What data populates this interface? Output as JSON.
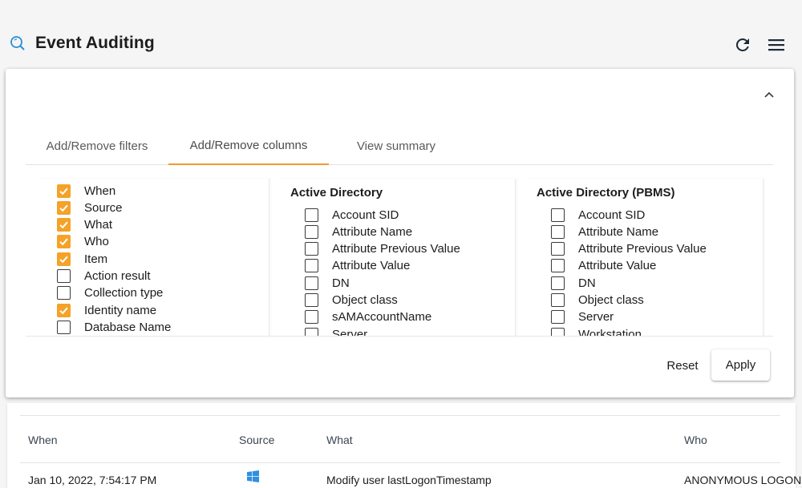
{
  "header": {
    "title": "Event Auditing",
    "icon": "search-icon",
    "actions": [
      "refresh-icon",
      "hamburger-menu-icon"
    ]
  },
  "panel": {
    "tabs": [
      {
        "label": "Add/Remove filters",
        "active": false
      },
      {
        "label": "Add/Remove columns",
        "active": true
      },
      {
        "label": "View summary",
        "active": false
      }
    ],
    "columns": [
      {
        "title": "",
        "options": [
          {
            "label": "When",
            "checked": true
          },
          {
            "label": "Source",
            "checked": true
          },
          {
            "label": "What",
            "checked": true
          },
          {
            "label": "Who",
            "checked": true
          },
          {
            "label": "Item",
            "checked": true
          },
          {
            "label": "Action result",
            "checked": false
          },
          {
            "label": "Collection type",
            "checked": false
          },
          {
            "label": "Identity name",
            "checked": true
          },
          {
            "label": "Database Name",
            "checked": false
          }
        ]
      },
      {
        "title": "Active Directory",
        "options": [
          {
            "label": "Account SID",
            "checked": false
          },
          {
            "label": "Attribute Name",
            "checked": false
          },
          {
            "label": "Attribute Previous Value",
            "checked": false
          },
          {
            "label": "Attribute Value",
            "checked": false
          },
          {
            "label": "DN",
            "checked": false
          },
          {
            "label": "Object class",
            "checked": false
          },
          {
            "label": "sAMAccountName",
            "checked": false
          },
          {
            "label": "Server",
            "checked": false
          }
        ]
      },
      {
        "title": "Active Directory (PBMS)",
        "options": [
          {
            "label": "Account SID",
            "checked": false
          },
          {
            "label": "Attribute Name",
            "checked": false
          },
          {
            "label": "Attribute Previous Value",
            "checked": false
          },
          {
            "label": "Attribute Value",
            "checked": false
          },
          {
            "label": "DN",
            "checked": false
          },
          {
            "label": "Object class",
            "checked": false
          },
          {
            "label": "Server",
            "checked": false
          },
          {
            "label": "Workstation",
            "checked": false
          }
        ]
      }
    ],
    "reset_label": "Reset",
    "apply_label": "Apply"
  },
  "table": {
    "headers": [
      "When",
      "Source",
      "What",
      "Who"
    ],
    "rows": [
      {
        "when": "Jan 10, 2022, 7:54:17 PM",
        "source_icon": "windows-icon",
        "what": "Modify user lastLogonTimestamp",
        "who": "ANONYMOUS LOGON"
      }
    ]
  },
  "colors": {
    "accent": "#f5a228",
    "tab_underline": "#f09a2e",
    "search_icon": "#2a8fd6",
    "windows_icon": "#2f8fe0"
  }
}
